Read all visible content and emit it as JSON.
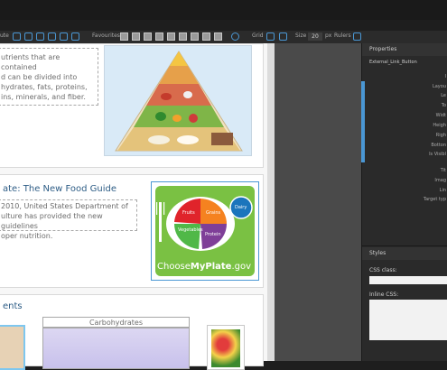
{
  "toolbar": {
    "partial_left": "ute",
    "favourites": "Favourites",
    "grid": "Grid",
    "size": "Size",
    "size_value": "20",
    "size_unit": "px",
    "rulers": "Rulers"
  },
  "page": {
    "section1_lines": [
      "utrients that are contained",
      "d can be divided into",
      "hydrates, fats, proteins,",
      "ins, minerals, and fiber."
    ],
    "section2_title": "ate: The New Food Guide",
    "section2_lines": [
      "2010, United States Department of",
      "ulture has provided the new guidelines",
      "oper nutrition."
    ],
    "myplate": {
      "fruits": "Fruits",
      "grains": "Grains",
      "vegetables": "Vegetables",
      "protein": "Protein",
      "dairy": "Dairy",
      "logo_choose": "Choose",
      "logo_myplate": "MyPlate",
      "logo_gov": ".gov"
    },
    "section3_title": "ents",
    "carbohydrates_label": "Carbohydrates"
  },
  "properties": {
    "header": "Properties",
    "element_name": "External_Link_Button",
    "rows": [
      "I",
      "Layou",
      "Le",
      "To",
      "Widt",
      "Heigh",
      "Righ",
      "Botton",
      "Is Visibl",
      "Tit",
      "Imag",
      "Lin",
      "Target typ"
    ],
    "styles_header": "Styles",
    "css_class_label": "CSS class:",
    "inline_css_label": "Inline CSS:"
  }
}
